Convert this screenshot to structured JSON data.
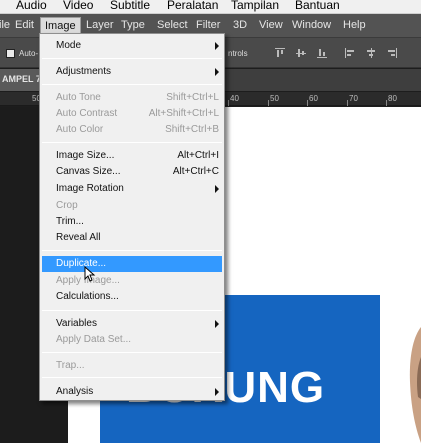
{
  "os_menu": {
    "items": [
      "Audio",
      "Video",
      "Subtitle",
      "Peralatan",
      "Tampilan",
      "Bantuan"
    ]
  },
  "ps_menu": {
    "items": [
      "ile",
      "Edit",
      "Image",
      "Layer",
      "Type",
      "Select",
      "Filter",
      "3D",
      "View",
      "Window",
      "Help"
    ],
    "active": "Image"
  },
  "options_bar": {
    "auto_select_label": "Auto-",
    "transform_label": "ntrols"
  },
  "doc_tab": {
    "label": "AMPEL 7."
  },
  "ruler": {
    "ticks": [
      "50",
      "40",
      "50",
      "60",
      "70",
      "80"
    ]
  },
  "canvas": {
    "sign_text": "BURUNG",
    "sign_color": "#1565c0"
  },
  "image_menu": {
    "items": [
      {
        "label": "Mode",
        "shortcut": "",
        "submenu": true,
        "disabled": false
      },
      {
        "label": "Adjustments",
        "shortcut": "",
        "submenu": true,
        "disabled": false
      },
      {
        "label": "Auto Tone",
        "shortcut": "Shift+Ctrl+L",
        "submenu": false,
        "disabled": true
      },
      {
        "label": "Auto Contrast",
        "shortcut": "Alt+Shift+Ctrl+L",
        "submenu": false,
        "disabled": true
      },
      {
        "label": "Auto Color",
        "shortcut": "Shift+Ctrl+B",
        "submenu": false,
        "disabled": true
      },
      {
        "label": "Image Size...",
        "shortcut": "Alt+Ctrl+I",
        "submenu": false,
        "disabled": false
      },
      {
        "label": "Canvas Size...",
        "shortcut": "Alt+Ctrl+C",
        "submenu": false,
        "disabled": false
      },
      {
        "label": "Image Rotation",
        "shortcut": "",
        "submenu": true,
        "disabled": false
      },
      {
        "label": "Crop",
        "shortcut": "",
        "submenu": false,
        "disabled": true
      },
      {
        "label": "Trim...",
        "shortcut": "",
        "submenu": false,
        "disabled": false
      },
      {
        "label": "Reveal All",
        "shortcut": "",
        "submenu": false,
        "disabled": false
      },
      {
        "label": "Duplicate...",
        "shortcut": "",
        "submenu": false,
        "disabled": false,
        "highlighted": true
      },
      {
        "label": "Apply Image...",
        "shortcut": "",
        "submenu": false,
        "disabled": true
      },
      {
        "label": "Calculations...",
        "shortcut": "",
        "submenu": false,
        "disabled": false
      },
      {
        "label": "Variables",
        "shortcut": "",
        "submenu": true,
        "disabled": false
      },
      {
        "label": "Apply Data Set...",
        "shortcut": "",
        "submenu": false,
        "disabled": true
      },
      {
        "label": "Trap...",
        "shortcut": "",
        "submenu": false,
        "disabled": true
      },
      {
        "label": "Analysis",
        "shortcut": "",
        "submenu": true,
        "disabled": false
      }
    ]
  },
  "colors": {
    "menu_highlight": "#3399ff",
    "disabled_text": "#9a9a9a"
  }
}
